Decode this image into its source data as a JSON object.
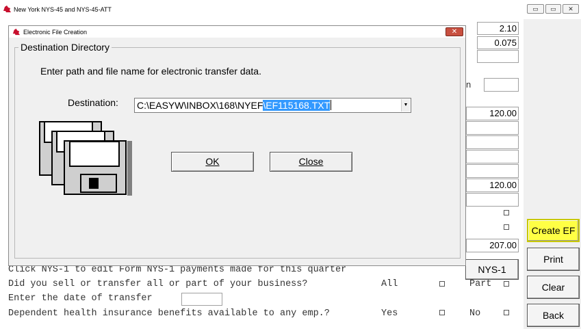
{
  "main_window": {
    "title": "New York NYS-45 and NYS-45-ATT",
    "controls": {
      "minimize": "▭",
      "maximize": "▭",
      "close": "✕"
    }
  },
  "fields": {
    "rate_1": "2.10",
    "rate_2": "0.075",
    "amount_1": "120.00",
    "amount_2": "120.00",
    "amount_3": "207.00",
    "partial_label": "n"
  },
  "questions": {
    "line_nys1": "Click NYS-1 to edit Form NYS-1 payments made for this quarter",
    "line_sell": "Did you sell or transfer all or part of your business?",
    "sell_opt_all": "All",
    "sell_opt_part": "Part",
    "line_date": "Enter the date of transfer",
    "line_health": "Dependent health insurance benefits available to any emp.?",
    "health_opt_yes": "Yes",
    "health_opt_no": "No"
  },
  "side_buttons": {
    "create_ef": "Create EF",
    "print": "Print",
    "clear": "Clear",
    "back": "Back",
    "nys1": "NYS-1"
  },
  "dialog": {
    "title": "Electronic File Creation",
    "group_label": "Destination Directory",
    "prompt": "Enter path and file name for electronic transfer data.",
    "destination_label": "Destination:",
    "path_prefix": "C:\\EASYW\\INBOX\\168\\NYEF",
    "path_selected": "\\EF115168.TXT",
    "ok_label": "OK",
    "close_label": "Close",
    "close_glyph": "✕"
  },
  "colors": {
    "highlight_button": "#ffff44",
    "selection": "#3399ff",
    "dialog_close": "#c85040"
  }
}
